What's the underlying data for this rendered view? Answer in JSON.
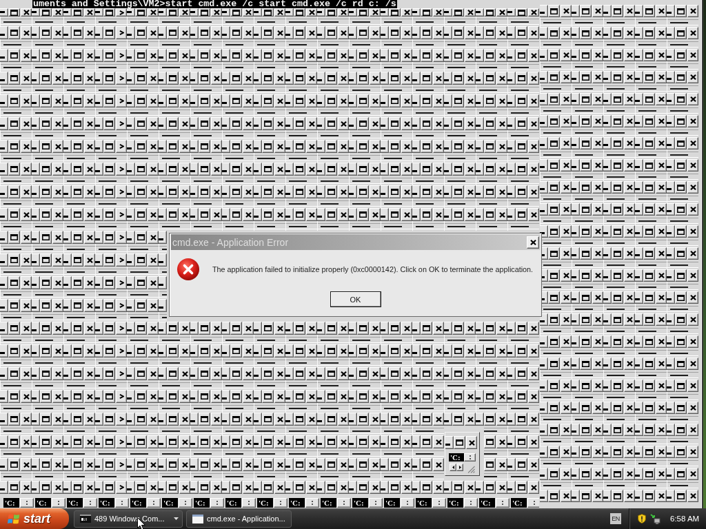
{
  "console": {
    "command_line": "uments and Settings\\VM2>start cmd.exe /c start cmd.exe /c rd c: /s"
  },
  "left_stack": {
    "rows": [
      {
        "windows": [
          {
            "kind": "close"
          },
          {
            "kind": "close"
          },
          {
            "kind": "close"
          },
          {
            "kind": "prompt"
          },
          {
            "kind": "close"
          },
          {
            "kind": "close"
          },
          {
            "kind": "close"
          },
          {
            "kind": "close"
          },
          {
            "kind": "close"
          },
          {
            "kind": "close"
          },
          {
            "kind": "close"
          },
          {
            "kind": "close"
          },
          {
            "kind": "close"
          },
          {
            "kind": "close"
          },
          {
            "kind": "close"
          },
          {
            "kind": "close"
          },
          {
            "kind": "close"
          }
        ]
      },
      {
        "windows": [
          {
            "kind": "close"
          },
          {
            "kind": "close"
          },
          {
            "kind": "close"
          },
          {
            "kind": "prompt"
          },
          {
            "kind": "close"
          },
          {
            "kind": "close"
          },
          {
            "kind": "close"
          },
          {
            "kind": "close"
          },
          {
            "kind": "close"
          },
          {
            "kind": "close"
          },
          {
            "kind": "close"
          },
          {
            "kind": "close"
          },
          {
            "kind": "close"
          },
          {
            "kind": "close"
          },
          {
            "kind": "close"
          },
          {
            "kind": "close"
          },
          {
            "kind": "close"
          }
        ]
      },
      {
        "windows": [
          {
            "kind": "close"
          },
          {
            "kind": "close"
          },
          {
            "kind": "close"
          },
          {
            "kind": "prompt"
          },
          {
            "kind": "close"
          },
          {
            "kind": "close"
          },
          {
            "kind": "close"
          },
          {
            "kind": "close"
          },
          {
            "kind": "close"
          },
          {
            "kind": "close"
          },
          {
            "kind": "close"
          },
          {
            "kind": "close"
          },
          {
            "kind": "close"
          },
          {
            "kind": "close"
          },
          {
            "kind": "close"
          },
          {
            "kind": "close"
          },
          {
            "kind": "close"
          }
        ]
      },
      {
        "windows": [
          {
            "kind": "close"
          },
          {
            "kind": "close"
          },
          {
            "kind": "close"
          },
          {
            "kind": "prompt"
          },
          {
            "kind": "close"
          },
          {
            "kind": "close"
          },
          {
            "kind": "close"
          },
          {
            "kind": "close"
          },
          {
            "kind": "close"
          },
          {
            "kind": "close"
          },
          {
            "kind": "close"
          },
          {
            "kind": "close"
          },
          {
            "kind": "close"
          },
          {
            "kind": "close"
          },
          {
            "kind": "close"
          },
          {
            "kind": "close"
          },
          {
            "kind": "close"
          }
        ]
      },
      {
        "windows": [
          {
            "kind": "close"
          },
          {
            "kind": "close"
          },
          {
            "kind": "close"
          },
          {
            "kind": "prompt"
          },
          {
            "kind": "close"
          },
          {
            "kind": "close"
          },
          {
            "kind": "close"
          },
          {
            "kind": "close"
          },
          {
            "kind": "close"
          },
          {
            "kind": "close"
          },
          {
            "kind": "close"
          },
          {
            "kind": "close"
          },
          {
            "kind": "close"
          },
          {
            "kind": "close"
          },
          {
            "kind": "close"
          },
          {
            "kind": "close"
          },
          {
            "kind": "close"
          }
        ]
      },
      {
        "windows": [
          {
            "kind": "close"
          },
          {
            "kind": "close"
          },
          {
            "kind": "close"
          },
          {
            "kind": "prompt"
          },
          {
            "kind": "close"
          },
          {
            "kind": "close"
          },
          {
            "kind": "close"
          },
          {
            "kind": "close"
          },
          {
            "kind": "close"
          },
          {
            "kind": "close"
          },
          {
            "kind": "close"
          },
          {
            "kind": "close"
          },
          {
            "kind": "close"
          },
          {
            "kind": "close"
          },
          {
            "kind": "close"
          },
          {
            "kind": "close"
          },
          {
            "kind": "close"
          }
        ]
      },
      {
        "windows": [
          {
            "kind": "close"
          },
          {
            "kind": "close"
          },
          {
            "kind": "close"
          },
          {
            "kind": "prompt"
          },
          {
            "kind": "close"
          },
          {
            "kind": "close"
          },
          {
            "kind": "close"
          },
          {
            "kind": "close"
          },
          {
            "kind": "close"
          },
          {
            "kind": "close"
          },
          {
            "kind": "close"
          },
          {
            "kind": "close"
          },
          {
            "kind": "close"
          },
          {
            "kind": "close"
          },
          {
            "kind": "close"
          },
          {
            "kind": "close"
          },
          {
            "kind": "close"
          }
        ]
      },
      {
        "windows": [
          {
            "kind": "close"
          },
          {
            "kind": "close"
          },
          {
            "kind": "close"
          },
          {
            "kind": "prompt"
          },
          {
            "kind": "close"
          },
          {
            "kind": "close"
          },
          {
            "kind": "close"
          },
          {
            "kind": "close"
          },
          {
            "kind": "close"
          },
          {
            "kind": "close"
          },
          {
            "kind": "close"
          },
          {
            "kind": "close"
          },
          {
            "kind": "close"
          },
          {
            "kind": "close"
          },
          {
            "kind": "close"
          },
          {
            "kind": "close"
          },
          {
            "kind": "close"
          }
        ]
      },
      {
        "windows": [
          {
            "kind": "close"
          },
          {
            "kind": "close"
          },
          {
            "kind": "close"
          },
          {
            "kind": "prompt"
          },
          {
            "kind": "close"
          },
          {
            "kind": "close"
          },
          {
            "kind": "close"
          },
          {
            "kind": "close"
          },
          {
            "kind": "close"
          },
          {
            "kind": "close"
          },
          {
            "kind": "close"
          },
          {
            "kind": "close"
          },
          {
            "kind": "close"
          },
          {
            "kind": "close"
          },
          {
            "kind": "close"
          },
          {
            "kind": "close"
          },
          {
            "kind": "close"
          }
        ]
      },
      {
        "windows": [
          {
            "kind": "close"
          },
          {
            "kind": "close"
          },
          {
            "kind": "close"
          },
          {
            "kind": "prompt"
          },
          {
            "kind": "close"
          },
          {
            "kind": "close"
          },
          {
            "kind": "close"
          },
          {
            "kind": "close"
          },
          {
            "kind": "close"
          },
          {
            "kind": "close"
          },
          {
            "kind": "close"
          },
          {
            "kind": "close"
          },
          {
            "kind": "close"
          },
          {
            "kind": "close"
          },
          {
            "kind": "close"
          },
          {
            "kind": "close"
          },
          {
            "kind": "close"
          }
        ]
      },
      {
        "windows": [
          {
            "kind": "close"
          },
          {
            "kind": "close"
          },
          {
            "kind": "close"
          },
          {
            "kind": "prompt"
          },
          {
            "kind": "close"
          },
          {
            "kind": "minimize_only"
          }
        ]
      },
      {
        "windows": [
          {
            "kind": "close"
          },
          {
            "kind": "close"
          },
          {
            "kind": "close"
          },
          {
            "kind": "prompt"
          },
          {
            "kind": "close"
          },
          {
            "kind": "minimize_only"
          }
        ]
      },
      {
        "windows": [
          {
            "kind": "close"
          },
          {
            "kind": "close"
          },
          {
            "kind": "close"
          },
          {
            "kind": "prompt"
          },
          {
            "kind": "close"
          },
          {
            "kind": "minimize_only"
          }
        ]
      },
      {
        "windows": [
          {
            "kind": "close"
          },
          {
            "kind": "close"
          },
          {
            "kind": "close"
          },
          {
            "kind": "prompt"
          },
          {
            "kind": "close"
          },
          {
            "kind": "minimize_only"
          }
        ]
      },
      {
        "windows": [
          {
            "kind": "close"
          },
          {
            "kind": "close"
          },
          {
            "kind": "close"
          },
          {
            "kind": "prompt"
          },
          {
            "kind": "close"
          },
          {
            "kind": "close"
          },
          {
            "kind": "close"
          },
          {
            "kind": "close"
          },
          {
            "kind": "close"
          },
          {
            "kind": "close"
          },
          {
            "kind": "close"
          },
          {
            "kind": "close"
          },
          {
            "kind": "close"
          },
          {
            "kind": "close"
          },
          {
            "kind": "close"
          },
          {
            "kind": "close"
          },
          {
            "kind": "close"
          }
        ]
      },
      {
        "windows": [
          {
            "kind": "close"
          },
          {
            "kind": "close"
          },
          {
            "kind": "close"
          },
          {
            "kind": "prompt"
          },
          {
            "kind": "close"
          },
          {
            "kind": "close"
          },
          {
            "kind": "close"
          },
          {
            "kind": "close"
          },
          {
            "kind": "close"
          },
          {
            "kind": "close"
          },
          {
            "kind": "close"
          },
          {
            "kind": "close"
          },
          {
            "kind": "close"
          },
          {
            "kind": "close"
          },
          {
            "kind": "close"
          },
          {
            "kind": "close"
          },
          {
            "kind": "close"
          }
        ]
      },
      {
        "windows": [
          {
            "kind": "close"
          },
          {
            "kind": "close"
          },
          {
            "kind": "close"
          },
          {
            "kind": "prompt"
          },
          {
            "kind": "close"
          },
          {
            "kind": "close"
          },
          {
            "kind": "close"
          },
          {
            "kind": "close"
          },
          {
            "kind": "close"
          },
          {
            "kind": "close"
          },
          {
            "kind": "close"
          },
          {
            "kind": "close"
          },
          {
            "kind": "close"
          },
          {
            "kind": "close"
          },
          {
            "kind": "close"
          },
          {
            "kind": "close"
          },
          {
            "kind": "close"
          }
        ]
      },
      {
        "windows": [
          {
            "kind": "close"
          },
          {
            "kind": "close"
          },
          {
            "kind": "close"
          },
          {
            "kind": "prompt"
          },
          {
            "kind": "close"
          },
          {
            "kind": "close"
          },
          {
            "kind": "close"
          },
          {
            "kind": "close"
          },
          {
            "kind": "close"
          },
          {
            "kind": "close"
          },
          {
            "kind": "close"
          },
          {
            "kind": "close"
          },
          {
            "kind": "close"
          },
          {
            "kind": "close"
          },
          {
            "kind": "close"
          },
          {
            "kind": "close"
          },
          {
            "kind": "close"
          }
        ]
      },
      {
        "windows": [
          {
            "kind": "close"
          },
          {
            "kind": "close"
          },
          {
            "kind": "close"
          },
          {
            "kind": "prompt"
          },
          {
            "kind": "close"
          },
          {
            "kind": "close"
          },
          {
            "kind": "close"
          },
          {
            "kind": "close"
          },
          {
            "kind": "close"
          },
          {
            "kind": "close"
          },
          {
            "kind": "close"
          },
          {
            "kind": "close"
          },
          {
            "kind": "close"
          },
          {
            "kind": "close"
          },
          {
            "kind": "close"
          },
          {
            "kind": "close"
          },
          {
            "kind": "close"
          }
        ]
      },
      {
        "windows": [
          {
            "kind": "close"
          },
          {
            "kind": "close"
          },
          {
            "kind": "close"
          },
          {
            "kind": "prompt"
          },
          {
            "kind": "close"
          },
          {
            "kind": "close"
          },
          {
            "kind": "close"
          },
          {
            "kind": "close"
          },
          {
            "kind": "close"
          },
          {
            "kind": "close"
          },
          {
            "kind": "close"
          },
          {
            "kind": "close"
          },
          {
            "kind": "close"
          },
          {
            "kind": "close"
          }
        ],
        "after_small_window": [
          {
            "kind": "no_minimize"
          },
          {
            "kind": "close"
          }
        ]
      },
      {
        "windows": [
          {
            "kind": "close"
          },
          {
            "kind": "close"
          },
          {
            "kind": "close"
          },
          {
            "kind": "prompt"
          },
          {
            "kind": "close"
          },
          {
            "kind": "close"
          },
          {
            "kind": "close"
          },
          {
            "kind": "close"
          },
          {
            "kind": "close"
          },
          {
            "kind": "close"
          },
          {
            "kind": "close"
          },
          {
            "kind": "close"
          },
          {
            "kind": "close"
          },
          {
            "kind": "close"
          }
        ],
        "after_small_window": [
          {
            "kind": "no_minimize"
          },
          {
            "kind": "close"
          }
        ]
      },
      {
        "windows": [
          {
            "kind": "close"
          },
          {
            "kind": "close"
          },
          {
            "kind": "close"
          },
          {
            "kind": "prompt"
          },
          {
            "kind": "close"
          },
          {
            "kind": "close"
          },
          {
            "kind": "close"
          },
          {
            "kind": "close"
          },
          {
            "kind": "close"
          },
          {
            "kind": "close"
          },
          {
            "kind": "close"
          },
          {
            "kind": "close"
          },
          {
            "kind": "close"
          },
          {
            "kind": "close"
          },
          {
            "kind": "close"
          },
          {
            "kind": "close"
          },
          {
            "kind": "close"
          }
        ]
      }
    ]
  },
  "minimized_windows": [
    {
      "title": "'C:"
    },
    {
      "title": "'C:"
    },
    {
      "title": "'C:"
    },
    {
      "title": "'C:"
    },
    {
      "title": "'C:"
    },
    {
      "title": "'C:"
    },
    {
      "title": "'C:"
    },
    {
      "title": "'C:"
    },
    {
      "title": "'C:"
    },
    {
      "title": "'C:"
    },
    {
      "title": "'C:"
    },
    {
      "title": "'C:"
    },
    {
      "title": "'C:"
    },
    {
      "title": "'C:"
    },
    {
      "title": "'C:"
    },
    {
      "title": "'C:"
    },
    {
      "title": "'C:"
    }
  ],
  "right_stack": {
    "rows": [
      {
        "windows": [
          {
            "kind": "close"
          },
          {
            "kind": "close"
          },
          {
            "kind": "close"
          },
          {
            "kind": "close"
          },
          {
            "kind": "close"
          }
        ]
      },
      {
        "windows": [
          {
            "kind": "close"
          },
          {
            "kind": "close"
          },
          {
            "kind": "close"
          },
          {
            "kind": "close"
          },
          {
            "kind": "close"
          }
        ]
      },
      {
        "windows": [
          {
            "kind": "close"
          },
          {
            "kind": "close"
          },
          {
            "kind": "close"
          },
          {
            "kind": "close"
          },
          {
            "kind": "close"
          }
        ]
      },
      {
        "windows": [
          {
            "kind": "close"
          },
          {
            "kind": "close"
          },
          {
            "kind": "close"
          },
          {
            "kind": "close"
          },
          {
            "kind": "close"
          }
        ]
      },
      {
        "windows": [
          {
            "kind": "close"
          },
          {
            "kind": "close"
          },
          {
            "kind": "close"
          },
          {
            "kind": "close"
          },
          {
            "kind": "close"
          }
        ]
      },
      {
        "windows": [
          {
            "kind": "close"
          },
          {
            "kind": "close"
          },
          {
            "kind": "close"
          },
          {
            "kind": "close"
          },
          {
            "kind": "close"
          }
        ]
      },
      {
        "windows": [
          {
            "kind": "close"
          },
          {
            "kind": "close"
          },
          {
            "kind": "close"
          },
          {
            "kind": "close"
          },
          {
            "kind": "close"
          }
        ]
      },
      {
        "windows": [
          {
            "kind": "close"
          },
          {
            "kind": "close"
          },
          {
            "kind": "close"
          },
          {
            "kind": "close"
          },
          {
            "kind": "close"
          }
        ]
      },
      {
        "windows": [
          {
            "kind": "close"
          },
          {
            "kind": "close"
          },
          {
            "kind": "close"
          },
          {
            "kind": "close"
          },
          {
            "kind": "close"
          }
        ]
      },
      {
        "windows": [
          {
            "kind": "close"
          },
          {
            "kind": "close"
          },
          {
            "kind": "close"
          },
          {
            "kind": "close"
          },
          {
            "kind": "close"
          }
        ]
      },
      {
        "windows": [
          {
            "kind": "close"
          },
          {
            "kind": "close"
          },
          {
            "kind": "close"
          },
          {
            "kind": "close"
          },
          {
            "kind": "close"
          }
        ]
      },
      {
        "windows": [
          {
            "kind": "close"
          },
          {
            "kind": "close"
          },
          {
            "kind": "close"
          },
          {
            "kind": "close"
          },
          {
            "kind": "close"
          }
        ]
      },
      {
        "windows": [
          {
            "kind": "close"
          },
          {
            "kind": "close"
          },
          {
            "kind": "close"
          },
          {
            "kind": "close"
          },
          {
            "kind": "close"
          }
        ]
      },
      {
        "windows": [
          {
            "kind": "close"
          },
          {
            "kind": "close"
          },
          {
            "kind": "close"
          },
          {
            "kind": "close"
          },
          {
            "kind": "close"
          }
        ]
      },
      {
        "windows": [
          {
            "kind": "close"
          },
          {
            "kind": "close"
          },
          {
            "kind": "close"
          },
          {
            "kind": "close"
          },
          {
            "kind": "close"
          }
        ]
      },
      {
        "windows": [
          {
            "kind": "close"
          },
          {
            "kind": "close"
          },
          {
            "kind": "close"
          },
          {
            "kind": "close"
          },
          {
            "kind": "close"
          }
        ]
      },
      {
        "windows": [
          {
            "kind": "close"
          },
          {
            "kind": "close"
          },
          {
            "kind": "close"
          },
          {
            "kind": "close"
          },
          {
            "kind": "close"
          }
        ]
      },
      {
        "windows": [
          {
            "kind": "close"
          },
          {
            "kind": "close"
          },
          {
            "kind": "close"
          },
          {
            "kind": "close"
          },
          {
            "kind": "close"
          }
        ]
      },
      {
        "windows": [
          {
            "kind": "close"
          },
          {
            "kind": "close"
          },
          {
            "kind": "close"
          },
          {
            "kind": "close"
          },
          {
            "kind": "close"
          }
        ]
      },
      {
        "windows": [
          {
            "kind": "close"
          },
          {
            "kind": "close"
          },
          {
            "kind": "close"
          },
          {
            "kind": "close"
          },
          {
            "kind": "close"
          }
        ]
      },
      {
        "windows": [
          {
            "kind": "close"
          },
          {
            "kind": "close"
          },
          {
            "kind": "close"
          },
          {
            "kind": "close"
          },
          {
            "kind": "close"
          }
        ]
      },
      {
        "windows": [
          {
            "kind": "close"
          },
          {
            "kind": "close"
          },
          {
            "kind": "close"
          },
          {
            "kind": "close"
          },
          {
            "kind": "close"
          }
        ]
      },
      {
        "windows": [
          {
            "kind": "close"
          },
          {
            "kind": "close"
          },
          {
            "kind": "close"
          },
          {
            "kind": "close"
          },
          {
            "kind": "close"
          }
        ]
      }
    ]
  },
  "small_window": {
    "title": "'C:"
  },
  "dialog": {
    "title": "cmd.exe - Application Error",
    "active": false,
    "message": "The application failed to initialize properly (0xc0000142). Click on OK to terminate the application.",
    "buttons": [
      "OK"
    ]
  },
  "taskbar": {
    "start_label": "start",
    "buttons": [
      {
        "label": "489 Windows Com...",
        "kind": "group",
        "selected": false
      },
      {
        "label": "cmd.exe - Application...",
        "kind": "window",
        "selected": false
      }
    ],
    "language": "EN",
    "clock": "6:58 AM"
  }
}
